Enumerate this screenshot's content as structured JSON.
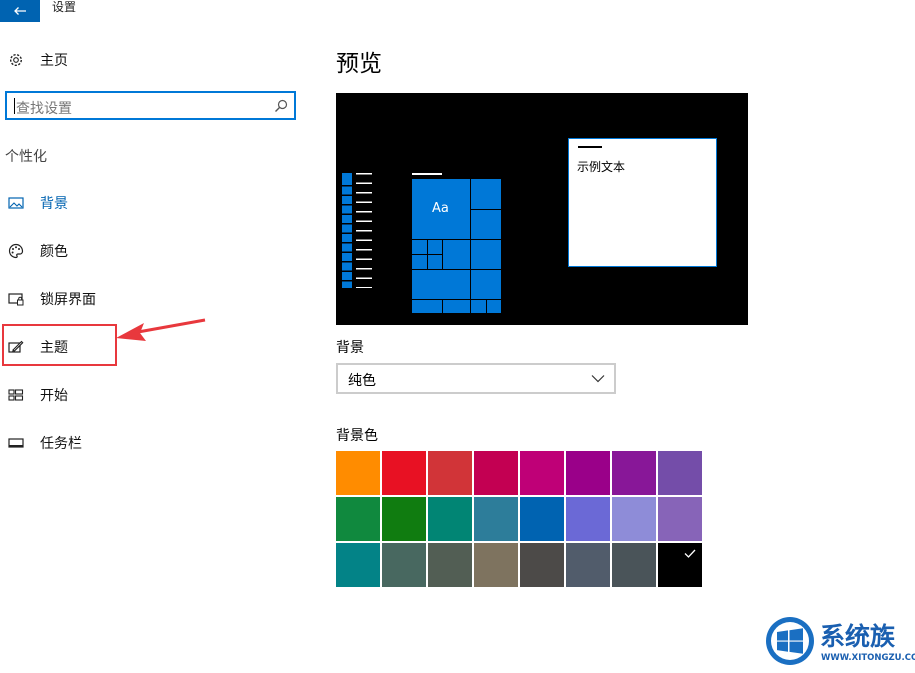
{
  "window": {
    "title": "设置"
  },
  "sidebar": {
    "home_label": "主页",
    "search_placeholder": "查找设置",
    "group_heading": "个性化",
    "items": [
      {
        "label": "背景",
        "icon": "picture-icon",
        "active": true
      },
      {
        "label": "颜色",
        "icon": "palette-icon",
        "active": false
      },
      {
        "label": "锁屏界面",
        "icon": "lock-screen-icon",
        "active": false
      },
      {
        "label": "主题",
        "icon": "theme-brush-icon",
        "active": false
      },
      {
        "label": "开始",
        "icon": "start-tiles-icon",
        "active": false
      },
      {
        "label": "任务栏",
        "icon": "taskbar-icon",
        "active": false
      }
    ]
  },
  "main": {
    "title": "预览",
    "preview": {
      "sample_text": "示例文本",
      "tile_text": "Aa",
      "background": "#000000",
      "accent": "#0078d7"
    },
    "background_label": "背景",
    "background_value": "纯色",
    "background_color_label": "背景色",
    "selected_color": "#000000",
    "colors": [
      [
        "#ff8c00",
        "#e81123",
        "#d13438",
        "#c30052",
        "#bf0077",
        "#9a0089",
        "#881798",
        "#744da9"
      ],
      [
        "#10893e",
        "#107c10",
        "#018574",
        "#2d7d9a",
        "#0063b1",
        "#6b69d6",
        "#8e8cd8",
        "#8764b8"
      ],
      [
        "#038387",
        "#486860",
        "#525e54",
        "#7e735f",
        "#4c4a48",
        "#515c6b",
        "#4a5459",
        "#000000"
      ]
    ]
  },
  "watermark": {
    "brand": "系统族",
    "url": "WWW.XITONGZU.COM"
  }
}
